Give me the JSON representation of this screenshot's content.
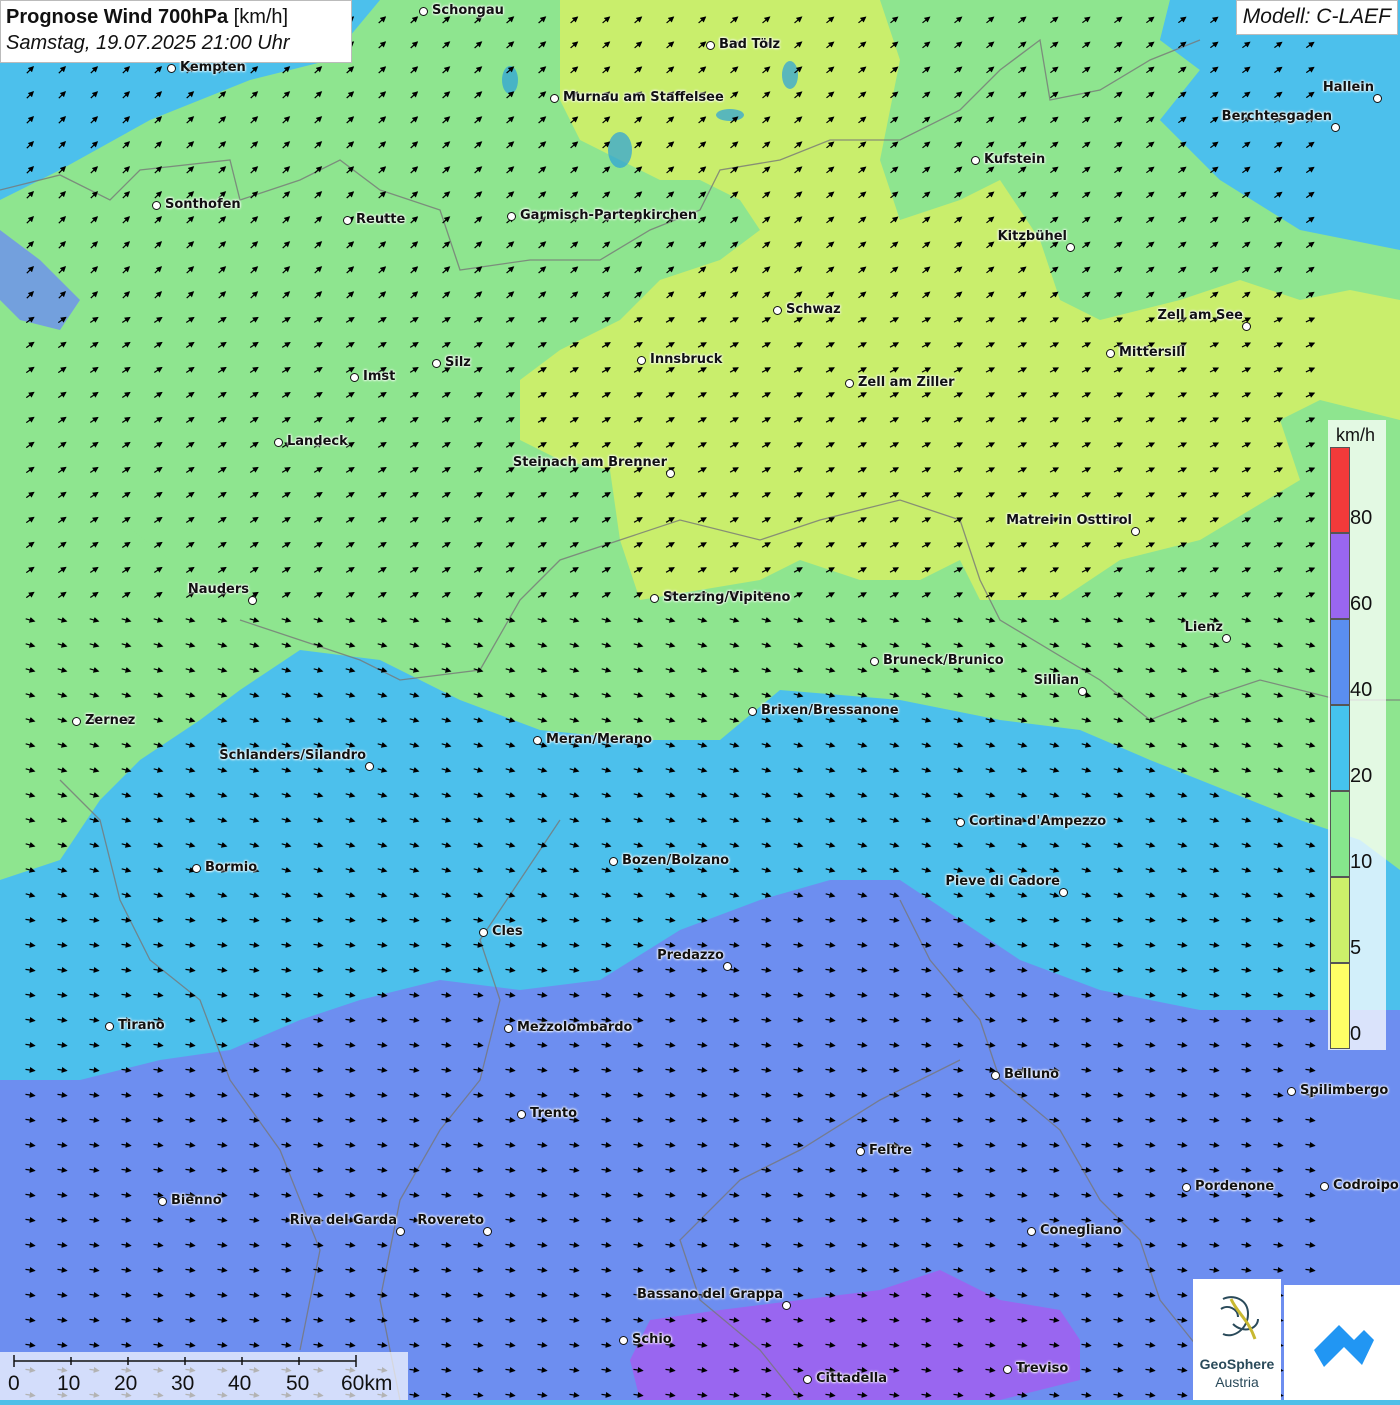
{
  "title": {
    "main": "Prognose Wind 700hPa",
    "unit": "[km/h]",
    "datetime": "Samstag, 19.07.2025 21:00 Uhr"
  },
  "model": "Modell: C-LAEF",
  "legend": {
    "unit": "km/h",
    "bins": [
      {
        "label": "0",
        "color": "#ffff66"
      },
      {
        "label": "5",
        "color": "#ccf06a"
      },
      {
        "label": "10",
        "color": "#86e68c"
      },
      {
        "label": "20",
        "color": "#45c3ee"
      },
      {
        "label": "40",
        "color": "#5a8ef0"
      },
      {
        "label": "60",
        "color": "#9966f0"
      },
      {
        "label": "80",
        "color": "#f23a3a"
      }
    ]
  },
  "scalebar": {
    "labels": [
      "0",
      "10",
      "20",
      "30",
      "40",
      "50",
      "60km"
    ]
  },
  "logo": {
    "name": "GeoSphere",
    "sub": "Austria"
  },
  "cities": [
    {
      "name": "Schongau"
    },
    {
      "name": "Bad Tölz"
    },
    {
      "name": "Kempten"
    },
    {
      "name": "Murnau am Staffelsee"
    },
    {
      "name": "Hallein"
    },
    {
      "name": "Berchtesgaden"
    },
    {
      "name": "Kufstein"
    },
    {
      "name": "Sonthofen"
    },
    {
      "name": "Reutte"
    },
    {
      "name": "Garmisch-Partenkirchen"
    },
    {
      "name": "Kitzbühel"
    },
    {
      "name": "Schwaz"
    },
    {
      "name": "Zell am See"
    },
    {
      "name": "Mittersill"
    },
    {
      "name": "Innsbruck"
    },
    {
      "name": "Silz"
    },
    {
      "name": "Imst"
    },
    {
      "name": "Zell am Ziller"
    },
    {
      "name": "Landeck"
    },
    {
      "name": "Steinach am Brenner"
    },
    {
      "name": "Matrei in Osttirol"
    },
    {
      "name": "Nauders"
    },
    {
      "name": "Sterzing/Vipiteno"
    },
    {
      "name": "Lienz"
    },
    {
      "name": "Bruneck/Brunico"
    },
    {
      "name": "Sillian"
    },
    {
      "name": "Brixen/Bressanone"
    },
    {
      "name": "Zernez"
    },
    {
      "name": "Meran/Merano"
    },
    {
      "name": "Schlanders/Silandro"
    },
    {
      "name": "Cortina d'Ampezzo"
    },
    {
      "name": "Bormio"
    },
    {
      "name": "Bozen/Bolzano"
    },
    {
      "name": "Pieve di Cadore"
    },
    {
      "name": "Cles"
    },
    {
      "name": "Predazzo"
    },
    {
      "name": "Tirano"
    },
    {
      "name": "Mezzolombardo"
    },
    {
      "name": "Belluno"
    },
    {
      "name": "Spilimbergo"
    },
    {
      "name": "Trento"
    },
    {
      "name": "Feltre"
    },
    {
      "name": "Bienno"
    },
    {
      "name": "Pordenone"
    },
    {
      "name": "Codroipo"
    },
    {
      "name": "Riva del Garda"
    },
    {
      "name": "Rovereto"
    },
    {
      "name": "Conegliano"
    },
    {
      "name": "Bassano del Grappa"
    },
    {
      "name": "Schio"
    },
    {
      "name": "Treviso"
    },
    {
      "name": "Cittadella"
    }
  ]
}
